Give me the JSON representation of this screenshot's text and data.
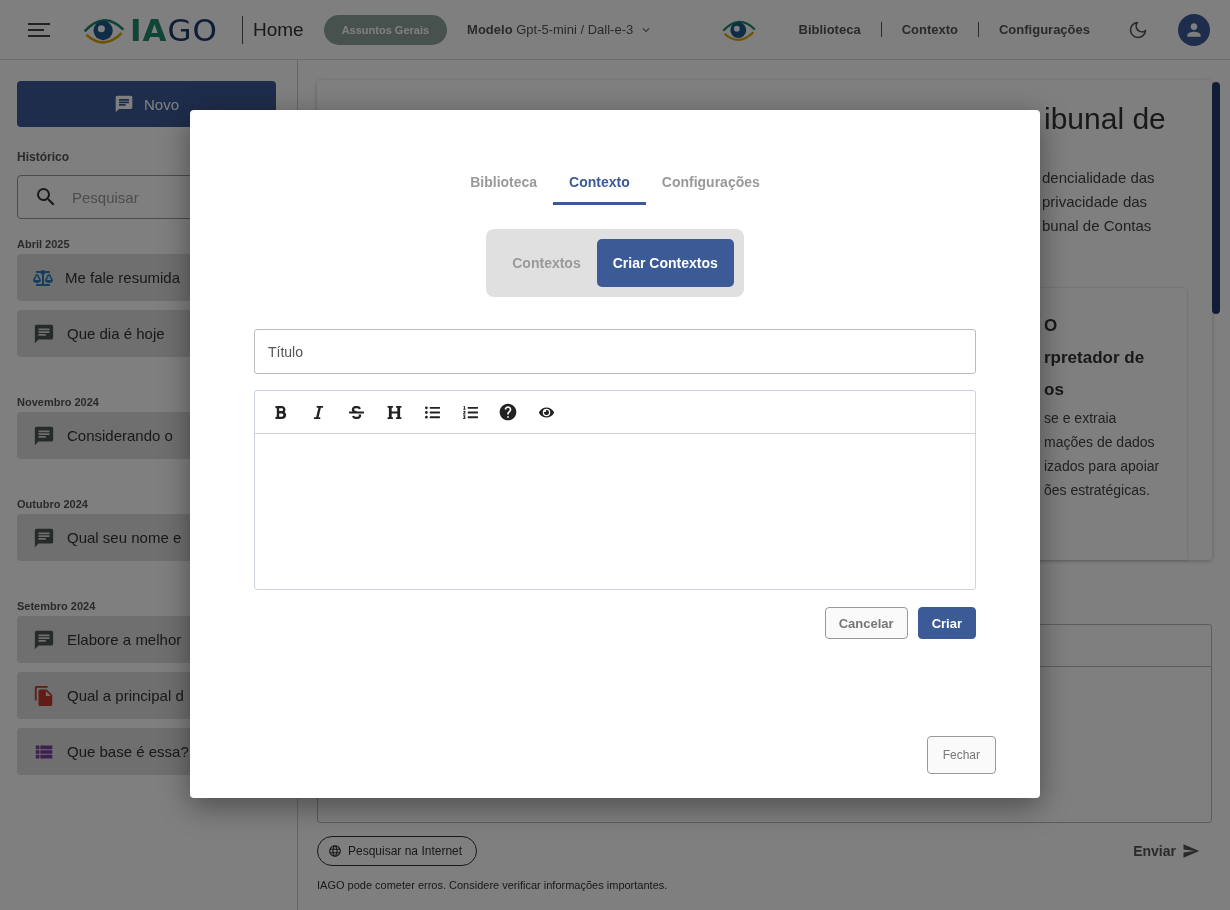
{
  "header": {
    "logo": {
      "accent": "IA",
      "rest": "GO"
    },
    "page_title": "Home",
    "topic_pill": "Assuntos Gerais",
    "model_label": "Modelo",
    "model_value": "Gpt-5-mini / Dall-e-3",
    "nav": [
      "Biblioteca",
      "Contexto",
      "Configurações"
    ]
  },
  "sidebar": {
    "new_button": "Novo",
    "history_title": "Histórico",
    "search": {
      "placeholder": "Pesquisar"
    },
    "groups": [
      {
        "label": "Abril 2025",
        "items": [
          {
            "kind": "law",
            "text": "Me fale resumida"
          },
          {
            "kind": "chat",
            "text": "Que dia é hoje"
          }
        ]
      },
      {
        "label": "Novembro 2024",
        "items": [
          {
            "kind": "chat",
            "text": "Considerando o"
          }
        ]
      },
      {
        "label": "Outubro 2024",
        "items": [
          {
            "kind": "chat",
            "text": "Qual seu nome e"
          }
        ]
      },
      {
        "label": "Setembro 2024",
        "items": [
          {
            "kind": "chat",
            "text": "Elabore a melhor"
          },
          {
            "kind": "document",
            "text": "Qual a principal d"
          },
          {
            "kind": "database",
            "text": "Que base é essa?"
          }
        ]
      }
    ]
  },
  "main": {
    "hero_title": "ibunal de",
    "hero_lines": [
      "dencialidade das",
      "privacidade das",
      "bunal de Contas"
    ],
    "card_title_lines": [
      "O",
      "rpretador de",
      "os"
    ],
    "card_lines": [
      "se e extraia",
      "mações de dados",
      "izados para apoiar",
      "ões estratégicas."
    ],
    "web_search_button": "Pesquisar na Internet",
    "send_button": "Enviar",
    "disclaimer": "IAGO pode cometer erros. Considere verificar informações importantes."
  },
  "modal": {
    "tabs": [
      {
        "label": "Biblioteca",
        "selected": false
      },
      {
        "label": "Contexto",
        "selected": true
      },
      {
        "label": "Configurações",
        "selected": false
      }
    ],
    "segments": [
      {
        "label": "Contextos",
        "selected": false
      },
      {
        "label": "Criar Contextos",
        "selected": true
      }
    ],
    "title_field": {
      "placeholder": "Título"
    },
    "cancel_button": "Cancelar",
    "create_button": "Criar",
    "close_button": "Fechar"
  }
}
